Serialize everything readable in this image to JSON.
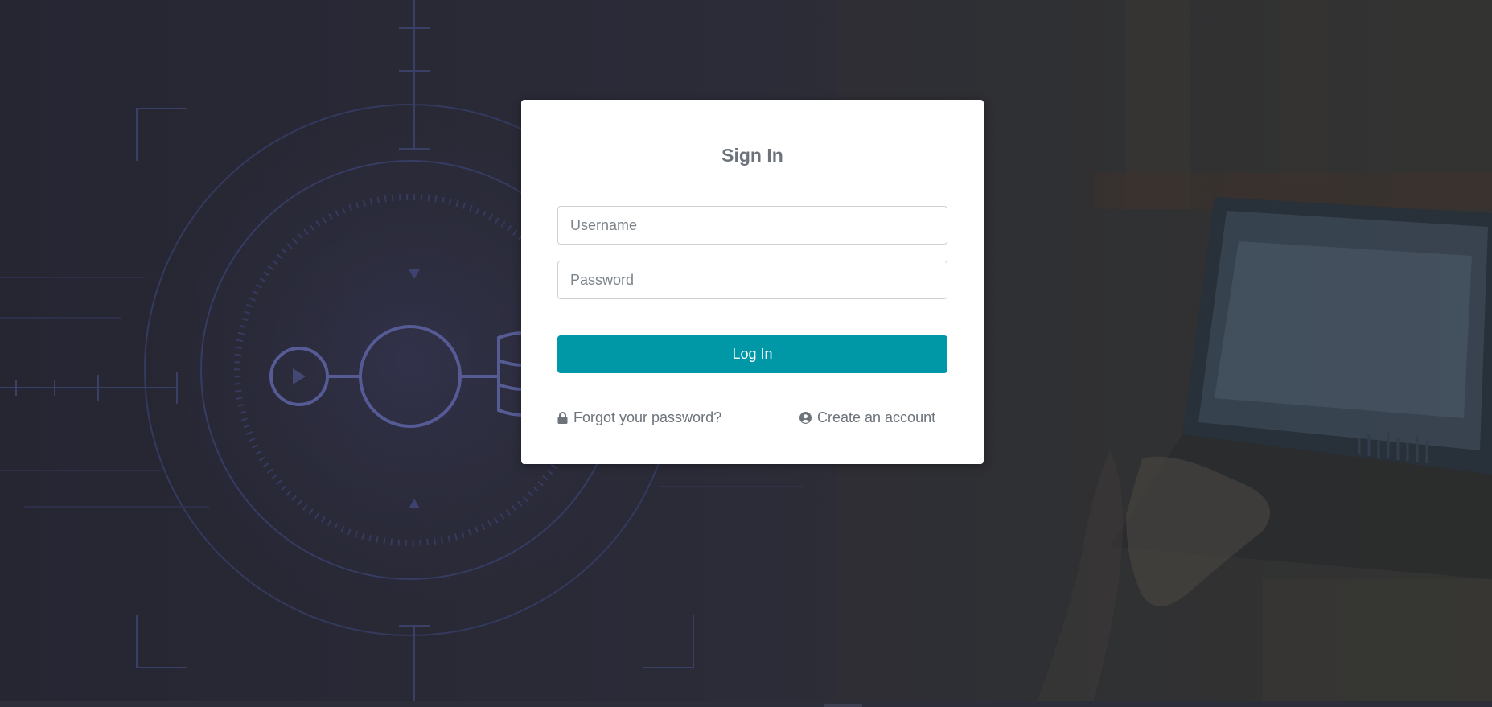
{
  "login": {
    "title": "Sign In",
    "username_placeholder": "Username",
    "password_placeholder": "Password",
    "submit_label": "Log In",
    "forgot_label": "Forgot your password?",
    "forgot_icon": "lock-icon",
    "create_label": "Create an account",
    "create_icon": "user-circle-icon"
  },
  "colors": {
    "accent": "#0097a7",
    "card_bg": "#ffffff",
    "text_muted": "#6c737a",
    "page_bg": "#2a2c33"
  }
}
